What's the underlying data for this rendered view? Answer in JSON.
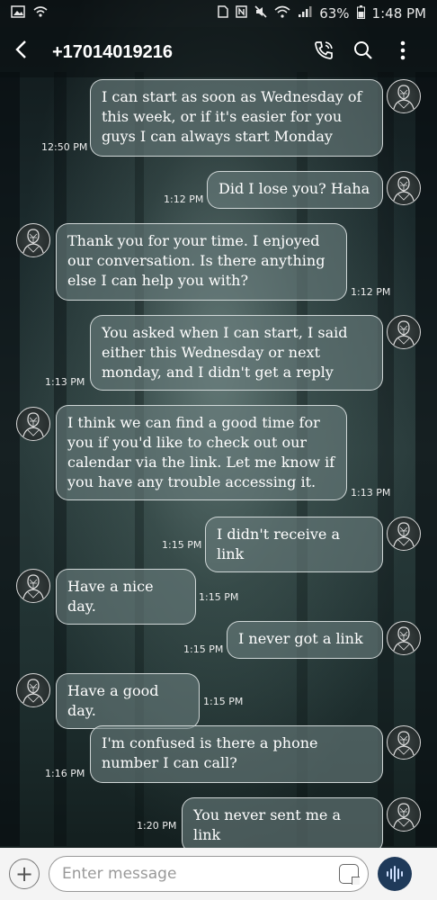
{
  "status_bar": {
    "left_icons": [
      "image-icon",
      "wifi-calling-icon"
    ],
    "right_icons": [
      "sim-icon",
      "nfc-icon",
      "mute-icon",
      "wifi-icon",
      "signal-icon"
    ],
    "battery": "63%",
    "time": "1:48 PM"
  },
  "header": {
    "back_icon": "back-arrow-icon",
    "title": "+17014019216",
    "call_icon": "phone-call-icon",
    "search_icon": "search-icon",
    "more_icon": "more-vertical-icon"
  },
  "messages": [
    {
      "side": "right",
      "text": "I can start as soon as Wednesday of this week, or if it's easier for you guys I can always start Monday",
      "time": "12:50 PM"
    },
    {
      "side": "right",
      "text": "Did I lose you? Haha",
      "time": "1:12 PM"
    },
    {
      "side": "left",
      "text": "Thank you for your time. I enjoyed our conversation. Is there anything else I can help you with?",
      "time": "1:12 PM"
    },
    {
      "side": "right",
      "text": "You asked when I can start, I said either this Wednesday or next monday, and I didn't get a reply",
      "time": "1:13 PM"
    },
    {
      "side": "left",
      "text": "I think we can find a good time for you if you'd like to check out our calendar via the link. Let me know if you have any trouble accessing it.",
      "time": "1:13 PM"
    },
    {
      "side": "right",
      "text": "I didn't receive a link",
      "time": "1:15 PM"
    },
    {
      "side": "left",
      "text": "Have a nice day.",
      "time": "1:15 PM"
    },
    {
      "side": "right",
      "text": "I never got a link",
      "time": "1:15 PM"
    },
    {
      "side": "left",
      "text": "Have a good day.",
      "time": "1:15 PM"
    },
    {
      "side": "right",
      "text": "I'm confused is there a phone number I can call?",
      "time": "1:16 PM"
    },
    {
      "side": "right",
      "text": "You never sent me a link",
      "time": "1:20 PM"
    }
  ],
  "composer": {
    "add_icon": "plus-icon",
    "placeholder": "Enter message",
    "sticker_icon": "sticker-icon",
    "voice_icon": "voice-input-icon"
  }
}
